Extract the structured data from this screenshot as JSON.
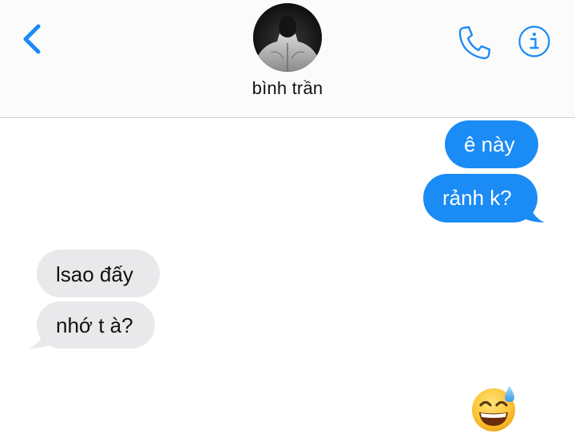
{
  "header": {
    "contact_name": "bình trần",
    "back_icon": "chevron-left-icon",
    "call_icon": "phone-icon",
    "info_icon": "info-icon",
    "accent_color": "#1b8bf5"
  },
  "messages": [
    {
      "direction": "sent",
      "text": "ê này"
    },
    {
      "direction": "sent",
      "text": "rảnh k?"
    },
    {
      "direction": "received",
      "text": "lsao đấy"
    },
    {
      "direction": "received",
      "text": "nhớ t à?"
    },
    {
      "direction": "sent",
      "emoji": "grinning-face-with-sweat-icon"
    }
  ],
  "colors": {
    "sent_bubble": "#1b8bf5",
    "received_bubble": "#e9e9eb",
    "header_bg": "#fbfbfb"
  }
}
